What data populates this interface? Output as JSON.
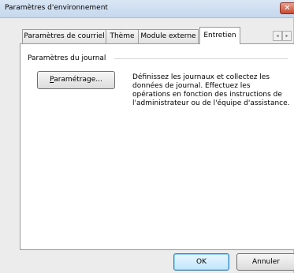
{
  "window": {
    "title": "Paramètres d'environnement",
    "close_glyph": "✕"
  },
  "tabs": [
    {
      "label": "Paramètres de courriel",
      "active": false
    },
    {
      "label": "Thème",
      "active": false
    },
    {
      "label": "Module externe",
      "active": false
    },
    {
      "label": "Entretien",
      "active": true
    }
  ],
  "tab_scroll": {
    "left": "◂",
    "right": "▸"
  },
  "journal": {
    "group_label": "Paramètres du journal",
    "setup_button_mnemonic": "P",
    "setup_button_rest": "aramétrage...",
    "description": "Définissez les journaux et collectez les données de journal. Effectuez les opérations en fonction des instructions de l'administrateur ou de l'équipe d'assistance."
  },
  "footer": {
    "ok_label": "OK",
    "cancel_label": "Annuler"
  }
}
